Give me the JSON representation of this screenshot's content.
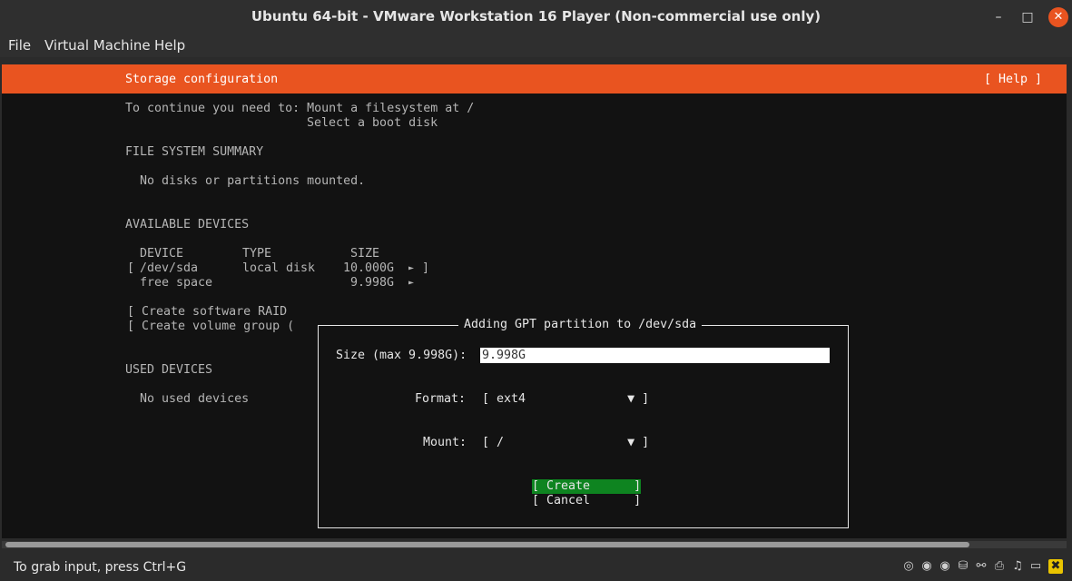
{
  "window": {
    "title": "Ubuntu 64-bit - VMware Workstation 16 Player (Non-commercial use only)",
    "min_icon": "–",
    "max_icon": "□",
    "close_icon": "✕"
  },
  "menubar": {
    "items": [
      "File",
      "Virtual Machine",
      "Help"
    ]
  },
  "installer": {
    "header_title": "Storage configuration",
    "header_help": "[ Help ]",
    "continue_line1": "To continue you need to: Mount a filesystem at /",
    "continue_line2": "Select a boot disk",
    "fs_summary_heading": "FILE SYSTEM SUMMARY",
    "fs_summary_text": "No disks or partitions mounted.",
    "available_heading": "AVAILABLE DEVICES",
    "columns": {
      "device": "DEVICE",
      "type": "TYPE",
      "size": "SIZE"
    },
    "devices": [
      {
        "bracket": "[",
        "device": "/dev/sda",
        "type": "local disk",
        "size": "10.000G",
        "arrow": "►",
        "close": "]"
      },
      {
        "bracket": "",
        "device": "free space",
        "type": "",
        "size": "9.998G",
        "arrow": "►",
        "close": ""
      }
    ],
    "create_raid": "[ Create software RAID",
    "create_vg": "[ Create volume group (",
    "used_heading": "USED DEVICES",
    "used_text": "No used devices"
  },
  "dialog": {
    "title": "Adding GPT partition to /dev/sda",
    "size_label": "Size (max 9.998G):",
    "size_value": "9.998G",
    "format_label": "Format:",
    "format_value": "[ ext4              ▼ ]",
    "mount_label": "Mount:",
    "mount_value": "[ /                 ▼ ]",
    "create_label": "[ Create      ]",
    "cancel_label": "[ Cancel      ]"
  },
  "statusbar": {
    "text": "To grab input, press Ctrl+G",
    "icons": [
      "◎",
      "◉",
      "◉",
      "⛁",
      "⚯",
      "⎙",
      "♫",
      "▭",
      "✖"
    ]
  }
}
